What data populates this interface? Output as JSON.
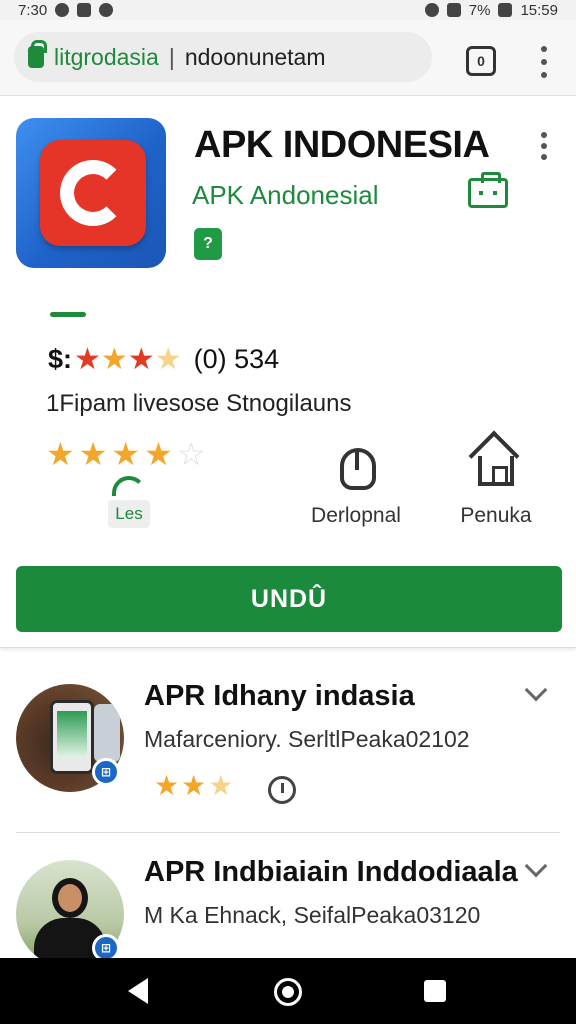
{
  "status_bar": {
    "time": "7:30",
    "battery": "7%",
    "clock_right": "15:59"
  },
  "browser": {
    "url_domain": "litgrodasia",
    "url_path": "ndoonunetam",
    "tabs_count": "0"
  },
  "app": {
    "title": "APK INDONESIA",
    "developer": "APK Andonesial",
    "rating_prefix": "$:",
    "rating_count": "(0) 534",
    "subtitle": "1Fipam livesose Stnogilauns",
    "les_label": "Les",
    "action_1_label": "Derlopnal",
    "action_2_label": "Penuka",
    "install_label": "UNDÛ"
  },
  "list": [
    {
      "title": "APR Idhany indasia",
      "subtitle": "Mafarceniory. SerltlPeaka02102"
    },
    {
      "title": "APR  Indbiaiain Inddodiaala",
      "subtitle": "M Ka Ehnack, SeifalPeaka03120"
    }
  ],
  "colors": {
    "accent": "#1c8a3c",
    "star_red": "#e23b25",
    "star_gold": "#f4a62a",
    "logo_blue": "#1f63c9"
  }
}
